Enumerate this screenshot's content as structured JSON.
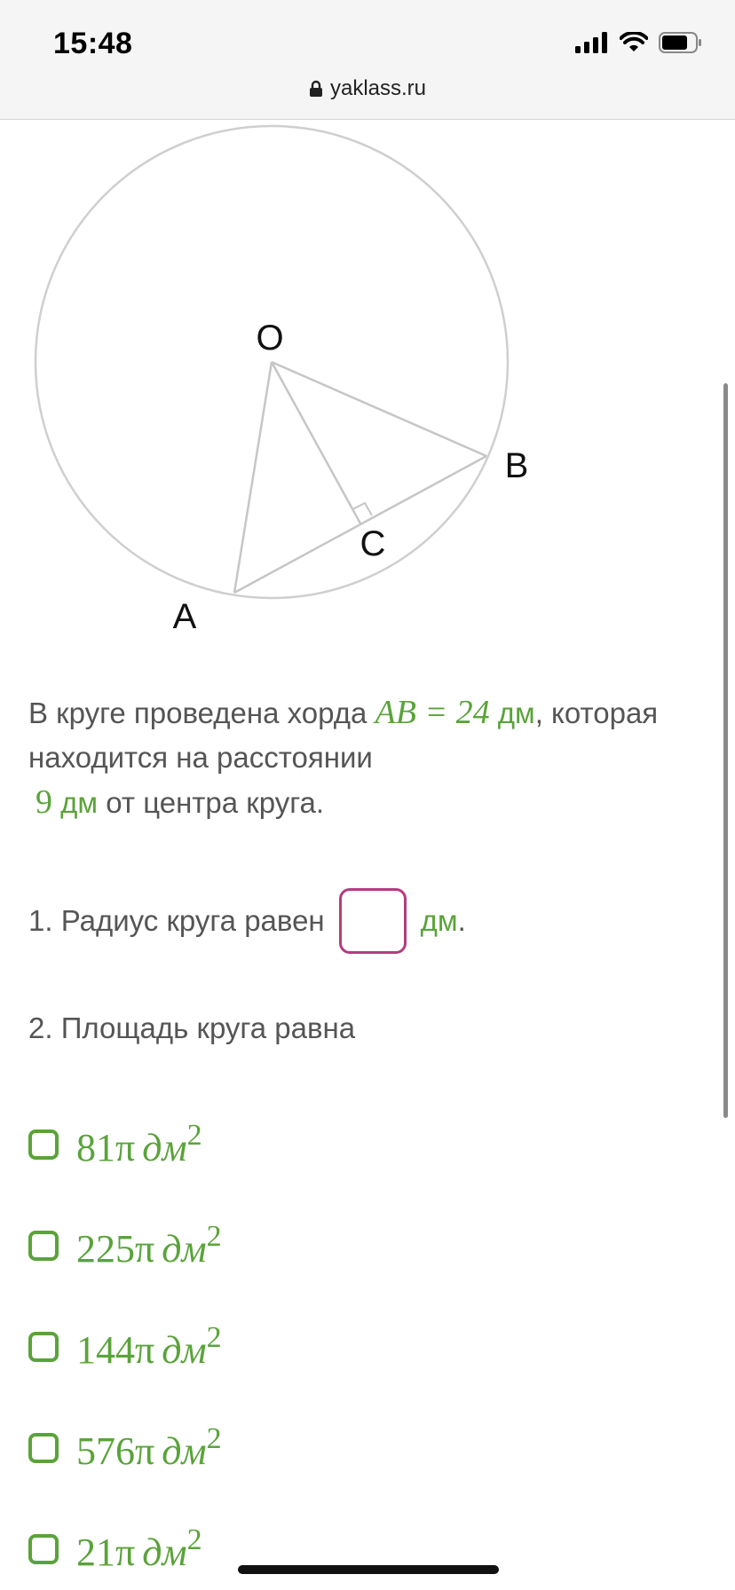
{
  "status_bar": {
    "time": "15:48",
    "url": "yaklass.ru"
  },
  "figure": {
    "labels": {
      "O": "O",
      "A": "A",
      "B": "B",
      "C": "C"
    }
  },
  "problem": {
    "text_part1": "В круге проведена хорда ",
    "math_chord": "AB = 24",
    "unit1": " дм",
    "text_part2": ", которая находится на расстоянии",
    "math_dist": "9",
    "unit2": " дм",
    "text_part3": " от центра круга."
  },
  "question1": {
    "label": "1. Радиус круга равен",
    "unit": "дм",
    "after": "."
  },
  "question2": {
    "label": "2. Площадь круга равна"
  },
  "options": [
    {
      "value": "81π",
      "unit": "дм",
      "power": "2"
    },
    {
      "value": "225π",
      "unit": "дм",
      "power": "2"
    },
    {
      "value": "144π",
      "unit": "дм",
      "power": "2"
    },
    {
      "value": "576π",
      "unit": "дм",
      "power": "2"
    },
    {
      "value": "21π",
      "unit": "дм",
      "power": "2"
    }
  ],
  "colors": {
    "accent_green": "#5aa33a",
    "input_border": "#b63b7e",
    "text": "#555555"
  }
}
